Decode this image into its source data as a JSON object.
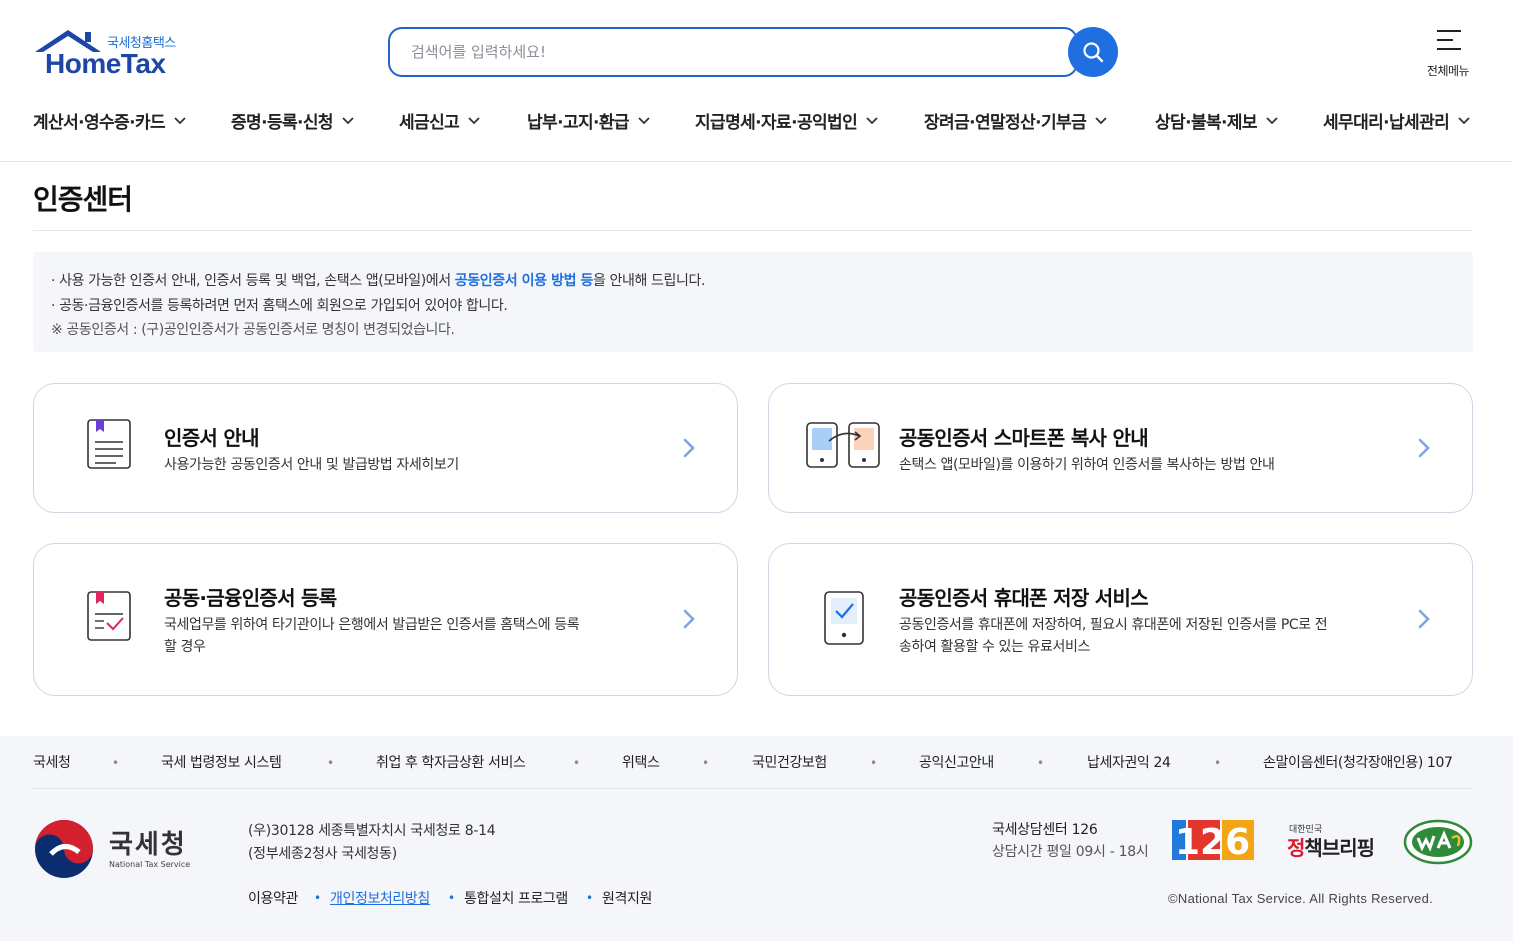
{
  "header": {
    "logo_sub": "국세청홈택스",
    "logo_main": "HomeTax",
    "search_placeholder": "검색어를 입력하세요!",
    "menu_all_label": "전체메뉴",
    "nav": [
      {
        "label": "계산서·영수증·카드"
      },
      {
        "label": "증명·등록·신청"
      },
      {
        "label": "세금신고"
      },
      {
        "label": "납부·고지·환급"
      },
      {
        "label": "지급명세·자료·공익법인"
      },
      {
        "label": "장려금·연말정산·기부금"
      },
      {
        "label": "상담·불복·제보"
      },
      {
        "label": "세무대리·납세관리"
      }
    ]
  },
  "page": {
    "title": "인증센터",
    "notice": {
      "line1_pre": "· 사용 가능한 인증서 안내, 인증서 등록 및 백업, 손택스 앱(모바일)에서 ",
      "line1_hl": "공동인증서 이용 방법 등",
      "line1_post": "을 안내해 드립니다.",
      "line2": "· 공동·금융인증서를 등록하려면 먼저 홈택스에 회원으로 가입되어 있어야 합니다.",
      "line3": "※ 공동인증서 : (구)공인인증서가 공동인증서로 명칭이 변경되었습니다."
    },
    "cards": [
      {
        "title": "인증서 안내",
        "desc": "사용가능한 공동인증서 안내 및 발급방법 자세히보기",
        "icon": "document-icon"
      },
      {
        "title": "공동인증서 스마트폰 복사 안내",
        "desc": "손택스 앱(모바일)를 이용하기 위하여 인증서를 복사하는 방법 안내",
        "icon": "phone-copy-icon"
      },
      {
        "title": "공동·금융인증서 등록",
        "desc": "국세업무를 위하여 타기관이나 은행에서 발급받은 인증서를 홈택스에 등록할 경우",
        "icon": "checklist-icon"
      },
      {
        "title": "공동인증서 휴대폰 저장 서비스",
        "desc": "공동인증서를 휴대폰에 저장하여, 필요시 휴대폰에 저장된 인증서를 PC로 전송하여 활용할 수 있는 유료서비스",
        "icon": "phone-check-icon"
      }
    ]
  },
  "footer": {
    "links": [
      "국세청",
      "국세 법령정보 시스템",
      "취업 후 학자금상환 서비스",
      "위택스",
      "국민건강보험",
      "공익신고안내",
      "납세자권익 24",
      "손말이음센터(청각장애인용) 107"
    ],
    "nts_name": "국세청",
    "nts_en": "National Tax Service",
    "address_line1": "(우)30128 세종특별자치시 국세청로 8-14",
    "address_line2": "(정부세종2청사 국세청동)",
    "bottom_links": [
      "이용약관",
      "개인정보처리방침",
      "통합설치 프로그램",
      "원격지원"
    ],
    "center_title": "국세상담센터 126",
    "center_hours": "상담시간 평일 09시 - 18시",
    "logo_126": "126",
    "policy_small": "대한민국",
    "policy_big_red": "정",
    "policy_big_rest": "책브리핑",
    "copyright": "©National Tax Service. All Rights Reserved."
  },
  "colors": {
    "accent": "#1f6fe0",
    "logo_blue": "#1d46a8",
    "card_border": "#cfd6e2",
    "notice_bg": "#f4f6fa"
  }
}
